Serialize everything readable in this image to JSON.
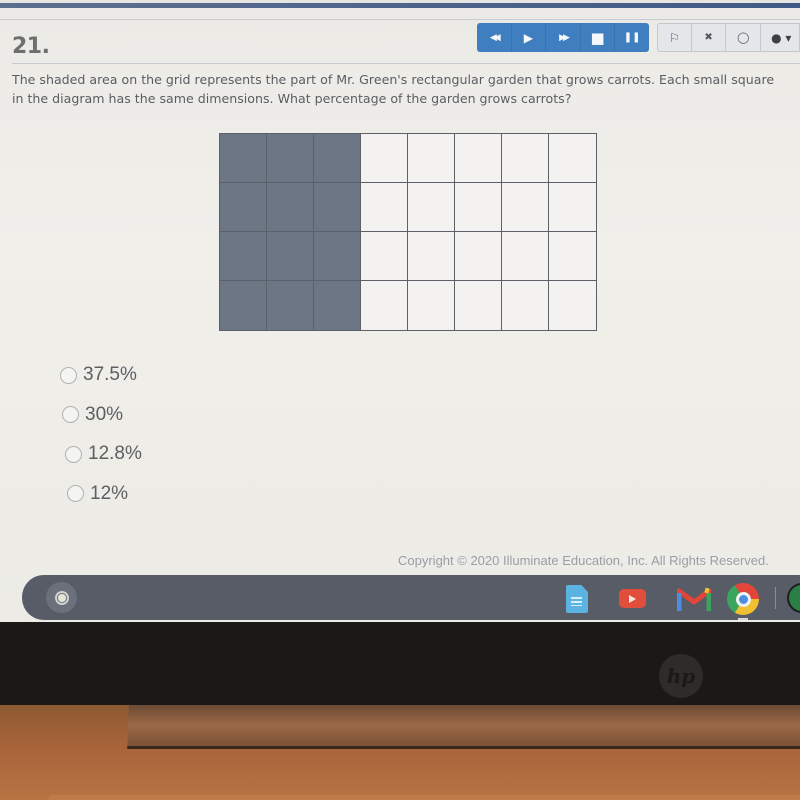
{
  "question": {
    "number": "21.",
    "text": "The shaded area on the grid represents the part of Mr. Green's rectangular garden that grows carrots.  Each small square in the diagram has the same dimensions. What percentage of the garden grows carrots?"
  },
  "media_controls": [
    {
      "name": "rewind-icon",
      "glyph": "◀◀"
    },
    {
      "name": "play-icon",
      "glyph": "▶"
    },
    {
      "name": "fast-forward-icon",
      "glyph": "▶▶"
    },
    {
      "name": "stop-icon",
      "glyph": "■"
    },
    {
      "name": "pause-icon",
      "glyph": "❚❚"
    }
  ],
  "tools": [
    {
      "name": "flag-icon",
      "glyph": "⚐"
    },
    {
      "name": "eliminate-icon",
      "glyph": "✖"
    },
    {
      "name": "comment-icon",
      "glyph": "◯"
    },
    {
      "name": "color-picker-icon",
      "glyph": "● ▾"
    }
  ],
  "diagram": {
    "rows": 4,
    "columns": 8,
    "shaded_columns": 3,
    "shaded_color": "#6d7685",
    "unshaded_color": "#f3f2f0"
  },
  "choices": [
    {
      "label": "37.5%",
      "selected": false
    },
    {
      "label": "30%",
      "selected": false
    },
    {
      "label": "12.8%",
      "selected": false
    },
    {
      "label": "12%",
      "selected": false
    }
  ],
  "footer": {
    "copyright": "Copyright © 2020 Illuminate Education, Inc. All Rights Reserved."
  },
  "shelf": {
    "apps": [
      "docs-icon",
      "youtube-icon",
      "gmail-icon",
      "chrome-icon",
      "spotify-icon"
    ]
  },
  "device": {
    "logo": "hp"
  },
  "colors": {
    "media_accent": "#3f7fbf",
    "text": "#5a5d62"
  }
}
